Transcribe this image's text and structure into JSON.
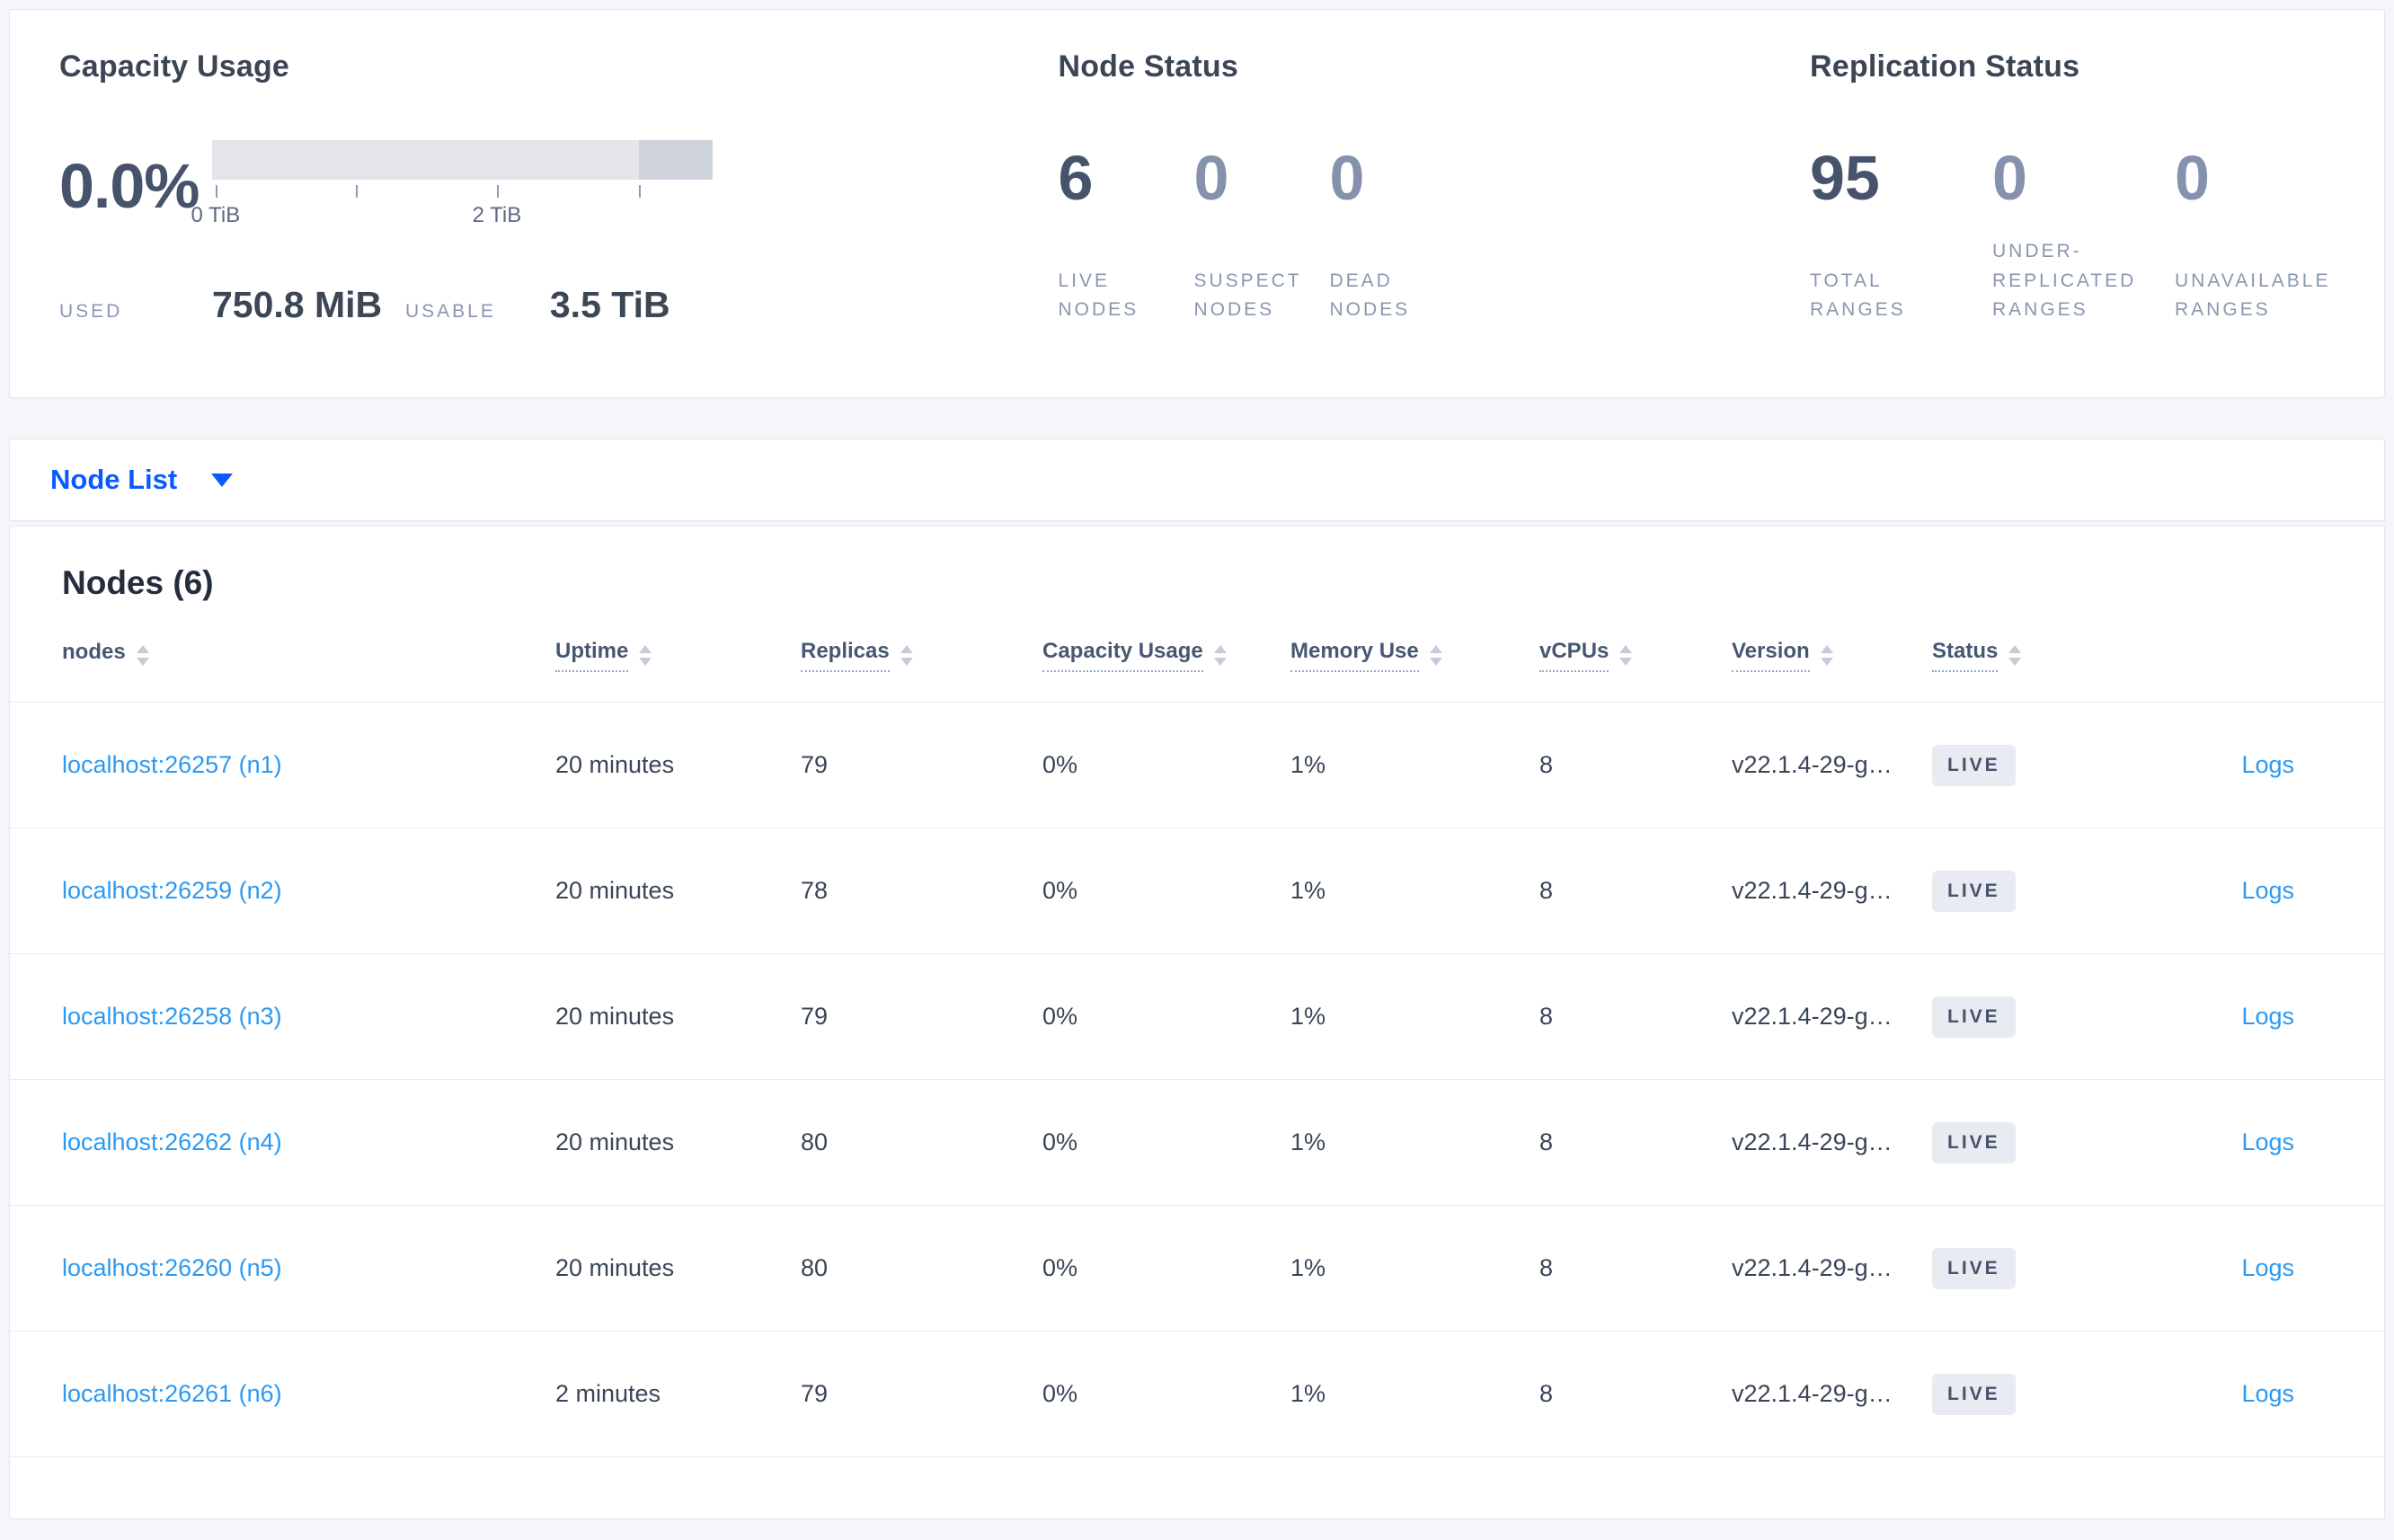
{
  "summary": {
    "capacity": {
      "title": "Capacity Usage",
      "percent": "0.0%",
      "tick_labels": [
        "0 TiB",
        "2 TiB"
      ],
      "used_label": "USED",
      "used_value": "750.8 MiB",
      "usable_label": "USABLE",
      "usable_value": "3.5 TiB"
    },
    "node_status": {
      "title": "Node Status",
      "stats": [
        {
          "value": "6",
          "label": "LIVE NODES"
        },
        {
          "value": "0",
          "label": "SUSPECT NODES"
        },
        {
          "value": "0",
          "label": "DEAD NODES"
        }
      ]
    },
    "replication": {
      "title": "Replication Status",
      "stats": [
        {
          "value": "95",
          "label": "TOTAL RANGES"
        },
        {
          "value": "0",
          "label": "UNDER-REPLICATED RANGES"
        },
        {
          "value": "0",
          "label": "UNAVAILABLE RANGES"
        }
      ]
    }
  },
  "node_list": {
    "label": "Node List"
  },
  "nodes_section": {
    "heading": "Nodes (6)",
    "columns": [
      "nodes",
      "Uptime",
      "Replicas",
      "Capacity Usage",
      "Memory Use",
      "vCPUs",
      "Version",
      "Status"
    ],
    "rows": [
      {
        "node": "localhost:26257 (n1)",
        "uptime": "20 minutes",
        "replicas": "79",
        "capacity": "0%",
        "memory": "1%",
        "vcpus": "8",
        "version": "v22.1.4-29-g…",
        "status": "LIVE",
        "logs": "Logs"
      },
      {
        "node": "localhost:26259 (n2)",
        "uptime": "20 minutes",
        "replicas": "78",
        "capacity": "0%",
        "memory": "1%",
        "vcpus": "8",
        "version": "v22.1.4-29-g…",
        "status": "LIVE",
        "logs": "Logs"
      },
      {
        "node": "localhost:26258 (n3)",
        "uptime": "20 minutes",
        "replicas": "79",
        "capacity": "0%",
        "memory": "1%",
        "vcpus": "8",
        "version": "v22.1.4-29-g…",
        "status": "LIVE",
        "logs": "Logs"
      },
      {
        "node": "localhost:26262 (n4)",
        "uptime": "20 minutes",
        "replicas": "80",
        "capacity": "0%",
        "memory": "1%",
        "vcpus": "8",
        "version": "v22.1.4-29-g…",
        "status": "LIVE",
        "logs": "Logs"
      },
      {
        "node": "localhost:26260 (n5)",
        "uptime": "20 minutes",
        "replicas": "80",
        "capacity": "0%",
        "memory": "1%",
        "vcpus": "8",
        "version": "v22.1.4-29-g…",
        "status": "LIVE",
        "logs": "Logs"
      },
      {
        "node": "localhost:26261 (n6)",
        "uptime": "2 minutes",
        "replicas": "79",
        "capacity": "0%",
        "memory": "1%",
        "vcpus": "8",
        "version": "v22.1.4-29-g…",
        "status": "LIVE",
        "logs": "Logs"
      }
    ]
  },
  "colors": {
    "accent_blue": "#0b5aff",
    "link_blue": "#2b99f2",
    "bar_light": "#e3e5ea",
    "bar_dark": "#ced2da",
    "badge_bg": "#e8ebf1",
    "text_dark": "#3b4655",
    "text_muted": "#8b96b0"
  }
}
